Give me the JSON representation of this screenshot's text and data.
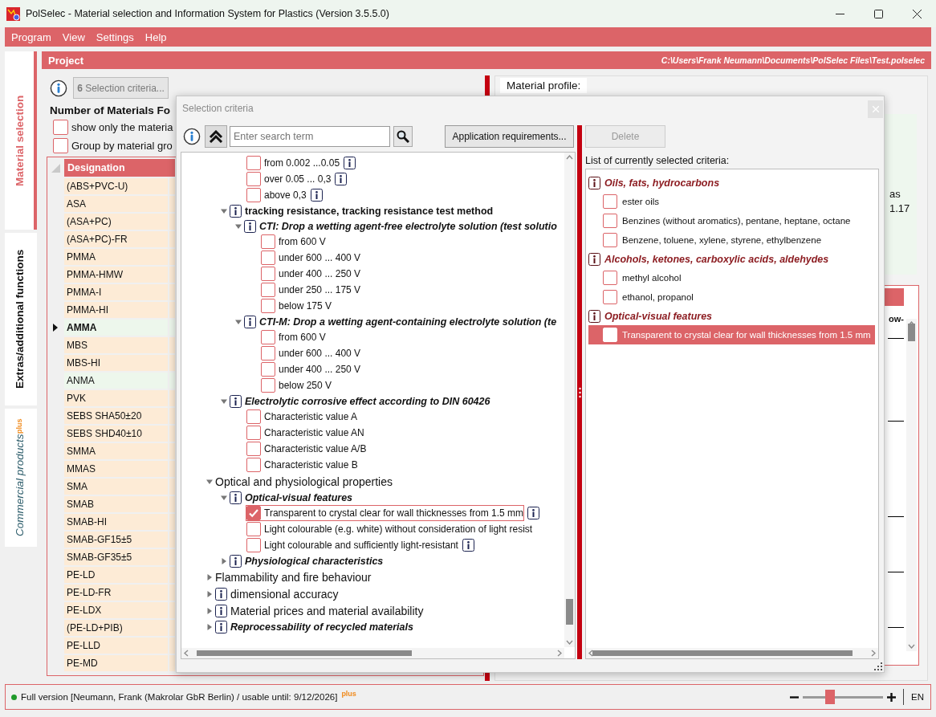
{
  "window": {
    "title": "PolSelec - Material selection and Information System for Plastics (Version 3.5.5.0)"
  },
  "menu": [
    "Program",
    "View",
    "Settings",
    "Help"
  ],
  "side_tabs": [
    {
      "label": "Material selection",
      "selected": true
    },
    {
      "label": "Extras/additional functions",
      "selected": false
    },
    {
      "label": "Commercial products",
      "badge": "plus",
      "selected": false
    }
  ],
  "project": {
    "title": "Project",
    "path": "C:\\Users\\Frank Neumann\\Documents\\PolSelec Files\\Test.polselec"
  },
  "selection_button": "**6** Selection criteria...",
  "materials_heading": "Number of Materials Fo",
  "options": [
    {
      "label": "show only the materia",
      "checked": false
    },
    {
      "label": "Group by material gro",
      "checked": false
    }
  ],
  "table": {
    "columns": [
      "Designation"
    ],
    "rows": [
      {
        "cells": [
          "(ABS+PVC-U)"
        ],
        "selected": false,
        "marked": false
      },
      {
        "cells": [
          "ASA"
        ],
        "selected": false,
        "marked": false
      },
      {
        "cells": [
          "(ASA+PC)"
        ],
        "selected": false,
        "marked": false
      },
      {
        "cells": [
          "(ASA+PC)-FR"
        ],
        "selected": false,
        "marked": false
      },
      {
        "cells": [
          "PMMA"
        ],
        "selected": false,
        "marked": false
      },
      {
        "cells": [
          "PMMA-HMW"
        ],
        "selected": false,
        "marked": false
      },
      {
        "cells": [
          "PMMA-I"
        ],
        "selected": false,
        "marked": false
      },
      {
        "cells": [
          "PMMA-HI"
        ],
        "selected": false,
        "marked": false
      },
      {
        "cells": [
          "AMMA"
        ],
        "selected": true,
        "marked": true
      },
      {
        "cells": [
          "MBS"
        ],
        "selected": false,
        "marked": false
      },
      {
        "cells": [
          "MBS-HI"
        ],
        "selected": false,
        "marked": false
      },
      {
        "cells": [
          "ANMA"
        ],
        "selected": false,
        "marked": true
      },
      {
        "cells": [
          "PVK"
        ],
        "selected": false,
        "marked": false
      },
      {
        "cells": [
          "SEBS SHA50±20"
        ],
        "selected": false,
        "marked": false
      },
      {
        "cells": [
          "SEBS SHD40±10"
        ],
        "selected": false,
        "marked": false
      },
      {
        "cells": [
          "SMMA"
        ],
        "selected": false,
        "marked": false
      },
      {
        "cells": [
          "MMAS"
        ],
        "selected": false,
        "marked": false
      },
      {
        "cells": [
          "SMA"
        ],
        "selected": false,
        "marked": false
      },
      {
        "cells": [
          "SMAB"
        ],
        "selected": false,
        "marked": false
      },
      {
        "cells": [
          "SMAB-HI"
        ],
        "selected": false,
        "marked": false
      },
      {
        "cells": [
          "SMAB-GF15±5"
        ],
        "selected": false,
        "marked": false
      },
      {
        "cells": [
          "SMAB-GF35±5"
        ],
        "selected": false,
        "marked": false
      },
      {
        "cells": [
          "PE-LD"
        ],
        "selected": false,
        "marked": false
      },
      {
        "cells": [
          "PE-LD-FR"
        ],
        "selected": false,
        "marked": false
      },
      {
        "cells": [
          "PE-LDX"
        ],
        "selected": false,
        "marked": false
      },
      {
        "cells": [
          "(PE-LD+PIB)"
        ],
        "selected": false,
        "marked": false
      },
      {
        "cells": [
          "PE-LLD"
        ],
        "selected": false,
        "marked": false
      },
      {
        "cells": [
          "PE-MD"
        ],
        "selected": false,
        "marked": false
      }
    ]
  },
  "profile": {
    "label": "Material profile:",
    "texts": [
      "as",
      "1.17"
    ],
    "list_text": "ow-"
  },
  "dialog": {
    "title": "Selection criteria",
    "search": {
      "placeholder": "Enter search term"
    },
    "requirements_button": {
      "label": "Application requirements...",
      "disabled": false
    },
    "delete_button": {
      "label": "Delete",
      "disabled": true
    },
    "tree": [
      {
        "children": [
          {
            "children": [
              {
                "kind": "option",
                "label": "from 0.002 ...0.05",
                "info": true,
                "checked": false,
                "selected": false
              },
              {
                "kind": "option",
                "label": "over 0.05 ... 0,3",
                "info": true,
                "checked": false,
                "selected": false
              },
              {
                "kind": "option",
                "label": "above 0,3",
                "info": true,
                "checked": false,
                "selected": false
              }
            ]
          },
          {
            "kind": "group",
            "label": "tracking resistance, tracking resistance test method",
            "info": true,
            "expanded": true,
            "children": [
              {
                "kind": "criterion",
                "label": "CTI: Drop a wetting agent-free electrolyte solution (test solutio",
                "info": true,
                "expanded": true,
                "children": [
                  {
                    "kind": "option",
                    "label": "from 600 V",
                    "info": false,
                    "checked": false,
                    "selected": false
                  },
                  {
                    "kind": "option",
                    "label": "under 600 ... 400 V",
                    "info": false,
                    "checked": false,
                    "selected": false
                  },
                  {
                    "kind": "option",
                    "label": "under 400 ... 250 V",
                    "info": false,
                    "checked": false,
                    "selected": false
                  },
                  {
                    "kind": "option",
                    "label": "under 250 ... 175 V",
                    "info": false,
                    "checked": false,
                    "selected": false
                  },
                  {
                    "kind": "option",
                    "label": "below 175 V",
                    "info": false,
                    "checked": false,
                    "selected": false
                  }
                ]
              },
              {
                "kind": "criterion",
                "label": "CTI-M: Drop a wetting agent-containing electrolyte solution (te",
                "info": true,
                "expanded": true,
                "children": [
                  {
                    "kind": "option",
                    "label": "from 600 V",
                    "info": false,
                    "checked": false,
                    "selected": false
                  },
                  {
                    "kind": "option",
                    "label": "under 600 ... 400 V",
                    "info": false,
                    "checked": false,
                    "selected": false
                  },
                  {
                    "kind": "option",
                    "label": "under 400 ... 250 V",
                    "info": false,
                    "checked": false,
                    "selected": false
                  },
                  {
                    "kind": "option",
                    "label": "below 250 V",
                    "info": false,
                    "checked": false,
                    "selected": false
                  }
                ]
              }
            ]
          },
          {
            "kind": "criterion",
            "label": "Electrolytic corrosive effect according to DIN 60426",
            "info": true,
            "expanded": true,
            "children": [
              {
                "kind": "option",
                "label": "Characteristic value A",
                "info": false,
                "checked": false,
                "selected": false
              },
              {
                "kind": "option",
                "label": "Characteristic value AN",
                "info": false,
                "checked": false,
                "selected": false
              },
              {
                "kind": "option",
                "label": "Characteristic value A/B",
                "info": false,
                "checked": false,
                "selected": false
              },
              {
                "kind": "option",
                "label": "Characteristic value B",
                "info": false,
                "checked": false,
                "selected": false
              }
            ]
          }
        ]
      },
      {
        "kind": "category",
        "label": "Optical and physiological properties",
        "info": false,
        "expanded": true,
        "children": [
          {
            "kind": "criterion",
            "label": "Optical-visual features",
            "info": true,
            "expanded": true,
            "children": [
              {
                "kind": "option",
                "label": "Transparent to crystal clear for wall thicknesses from 1.5 mm",
                "info": true,
                "checked": true,
                "selected": true
              },
              {
                "kind": "option",
                "label": "Light colourable (e.g. white) without consideration of light resist",
                "info": false,
                "checked": false,
                "selected": false
              },
              {
                "kind": "option",
                "label": "Light colourable and sufficiently light-resistant",
                "info": true,
                "checked": false,
                "selected": false
              }
            ]
          },
          {
            "kind": "criterion",
            "label": "Physiological characteristics",
            "info": true,
            "expanded": false
          }
        ]
      },
      {
        "kind": "category",
        "label": "Flammability and fire behaviour",
        "info": false,
        "expanded": false
      },
      {
        "kind": "category",
        "label": "dimensional accuracy",
        "info": true,
        "expanded": false
      },
      {
        "kind": "category",
        "label": "Material prices and material availability",
        "info": true,
        "expanded": false
      },
      {
        "kind": "criterion",
        "label": "Reprocessability of recycled materials",
        "info": true,
        "expanded": false
      }
    ],
    "selected_list_label": "List of currently selected criteria:",
    "selected_criteria": [
      {
        "label": "Oils, fats, hydrocarbons",
        "children": [
          {
            "label": "ester oils",
            "checked": false,
            "selected": false
          },
          {
            "label": "Benzines (without aromatics), pentane, heptane, octane",
            "checked": false,
            "selected": false
          },
          {
            "label": "Benzene, toluene, xylene, styrene, ethylbenzene",
            "checked": false,
            "selected": false
          }
        ]
      },
      {
        "label": "Alcohols, ketones, carboxylic acids, aldehydes",
        "children": [
          {
            "label": "methyl alcohol",
            "checked": false,
            "selected": false
          },
          {
            "label": "ethanol, propanol",
            "checked": false,
            "selected": false
          }
        ]
      },
      {
        "label": "Optical-visual features",
        "children": [
          {
            "label": "Transparent to crystal clear for wall thicknesses from 1.5 mm",
            "checked": false,
            "selected": true
          }
        ]
      }
    ]
  },
  "status_bar": {
    "text": "Full version [Neumann, Frank (Makrolar GbR Berlin) / usable until: 9/12/2026]",
    "badge": "plus",
    "zoom": {
      "level": 0.34
    },
    "language": "EN"
  }
}
